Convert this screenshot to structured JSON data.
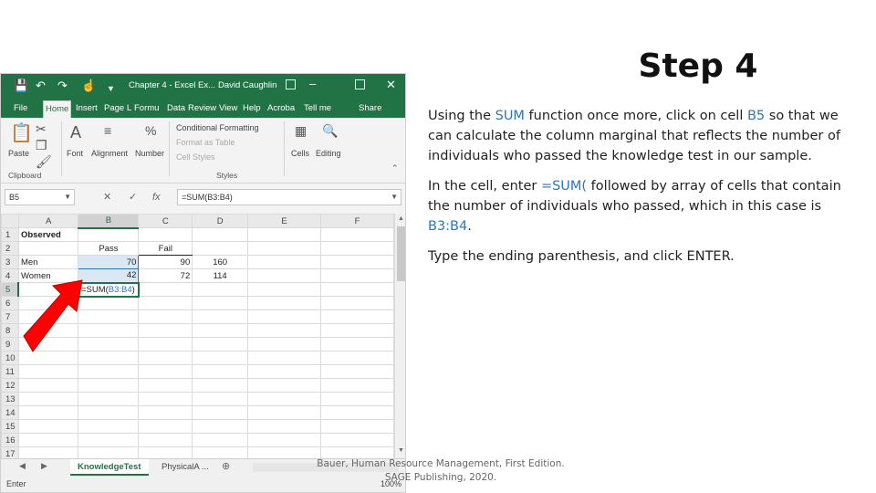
{
  "slide": {
    "title": "Step 4",
    "p1_a": "Using the ",
    "p1_b": "SUM",
    "p1_c": " function once more, click on cell ",
    "p1_d": "B5",
    "p1_e": " so that we can calculate the column marginal that reflects the number of individuals who passed the knowledge test in our sample.",
    "p2_a": "In the cell, enter ",
    "p2_b": "=SUM(",
    "p2_c": " followed by array of cells that contain the number of individuals who passed, which in this case is ",
    "p2_d": "B3:B4",
    "p2_e": ".",
    "p3": "Type the ending parenthesis, and click ENTER.",
    "footer": "Bauer, Human Resource Management, First Edition. SAGE Publishing, 2020."
  },
  "excel": {
    "title_doc": "Chapter 4 - Excel Ex...",
    "title_user": "David Caughlin",
    "tabs": [
      "File",
      "Home",
      "Insert",
      "Page L",
      "Formu",
      "Data",
      "Review",
      "View",
      "Help",
      "Acroba",
      "Tell me",
      "Share"
    ],
    "ribbon": {
      "paste": "Paste",
      "clipboard": "Clipboard",
      "font": "Font",
      "alignment": "Alignment",
      "number": "Number",
      "conditional": "Conditional Formatting",
      "format_table": "Format as Table",
      "cell_styles": "Cell Styles",
      "styles": "Styles",
      "cells": "Cells",
      "editing": "Editing"
    },
    "name_box": "B5",
    "formula": "=SUM(B3:B4)",
    "columns": [
      "A",
      "B",
      "C",
      "D",
      "E",
      "F"
    ],
    "rows": [
      {
        "n": "1",
        "a": "Observed",
        "b": "",
        "c": "",
        "d": ""
      },
      {
        "n": "2",
        "a": "",
        "b": "Pass",
        "c": "Fail",
        "d": ""
      },
      {
        "n": "3",
        "a": "Men",
        "b": "70",
        "c": "90",
        "d": "160"
      },
      {
        "n": "4",
        "a": "Women",
        "b": "42",
        "c": "72",
        "d": "114"
      },
      {
        "n": "5",
        "a": "",
        "b": "",
        "c": "",
        "d": ""
      },
      {
        "n": "6"
      },
      {
        "n": "7"
      },
      {
        "n": "8"
      },
      {
        "n": "9"
      },
      {
        "n": "10"
      },
      {
        "n": "11"
      },
      {
        "n": "12"
      },
      {
        "n": "13"
      },
      {
        "n": "14"
      },
      {
        "n": "15"
      },
      {
        "n": "16"
      },
      {
        "n": "17"
      }
    ],
    "cell_b5_prefix": "=SUM(",
    "cell_b5_ref": "B3:B4",
    "cell_b5_suffix": ")",
    "sheet_tabs": [
      "KnowledgeTest",
      "PhysicalA ..."
    ],
    "status": "Enter",
    "zoom": "100%",
    "accent": "#217346",
    "arrow_color": "#ff0000"
  }
}
